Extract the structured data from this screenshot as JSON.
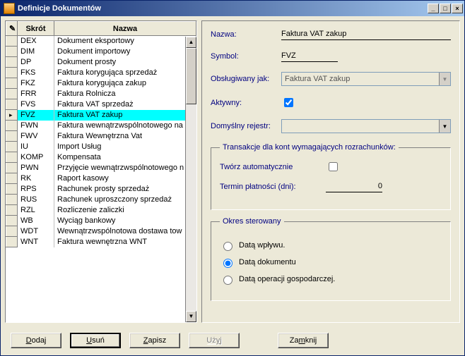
{
  "window": {
    "title": "Definicje Dokumentów"
  },
  "grid": {
    "columns": [
      "",
      "Skrót",
      "Nazwa"
    ],
    "selected_index": 7,
    "rows": [
      {
        "short": "DEX",
        "name": "Dokument eksportowy"
      },
      {
        "short": "DIM",
        "name": "Dokument importowy"
      },
      {
        "short": "DP",
        "name": "Dokument prosty"
      },
      {
        "short": "FKS",
        "name": "Faktura korygująca sprzedaż"
      },
      {
        "short": "FKZ",
        "name": "Faktura korygująca zakup"
      },
      {
        "short": "FRR",
        "name": "Faktura Rolnicza"
      },
      {
        "short": "FVS",
        "name": "Faktura VAT sprzedaż"
      },
      {
        "short": "FVZ",
        "name": "Faktura VAT zakup"
      },
      {
        "short": "FWN",
        "name": "Faktura wewnątrzwspólnotowego na"
      },
      {
        "short": "FWV",
        "name": "Faktura Wewnętrzna Vat"
      },
      {
        "short": "IU",
        "name": "Import Usług"
      },
      {
        "short": "KOMP",
        "name": "Kompensata"
      },
      {
        "short": "PWN",
        "name": "Przyjęcie wewnątrzwspólnotowego n"
      },
      {
        "short": "RK",
        "name": "Raport kasowy"
      },
      {
        "short": "RPS",
        "name": "Rachunek prosty sprzedaż"
      },
      {
        "short": "RUS",
        "name": "Rachunek uproszczony sprzedaż"
      },
      {
        "short": "RZL",
        "name": "Rozliczenie zaliczki"
      },
      {
        "short": "WB",
        "name": "Wyciąg bankowy"
      },
      {
        "short": "WDT",
        "name": "Wewnątrzwspólnotowa dostawa tow"
      },
      {
        "short": "WNT",
        "name": "Faktura wewnętrzna WNT"
      }
    ]
  },
  "form": {
    "nazwa": {
      "label": "Nazwa:",
      "value": "Faktura VAT zakup"
    },
    "symbol": {
      "label": "Symbol:",
      "value": "FVZ"
    },
    "obslugiwany": {
      "label": "Obsługiwany jak:",
      "value": "Faktura VAT zakup"
    },
    "aktywny": {
      "label": "Aktywny:",
      "checked": true
    },
    "rejestr": {
      "label": "Domyślny rejestr:",
      "value": ""
    }
  },
  "transakcje": {
    "legend": "Transakcje dla kont wymagających rozrachunków:",
    "tworz": {
      "label": "Twórz automatycznie",
      "checked": false
    },
    "termin": {
      "label": "Termin płatności (dni):",
      "value": "0"
    }
  },
  "okres": {
    "legend": "Okres sterowany",
    "options": [
      {
        "label": "Datą wpływu.",
        "checked": false
      },
      {
        "label": "Datą dokumentu",
        "checked": true
      },
      {
        "label": "Datą operacji gospodarczej.",
        "checked": false
      }
    ]
  },
  "buttons": {
    "dodaj": "Dodaj",
    "usun": "Usuń",
    "zapisz": "Zapisz",
    "uzyj": "Użyj",
    "zamknij": "Zamknij"
  }
}
